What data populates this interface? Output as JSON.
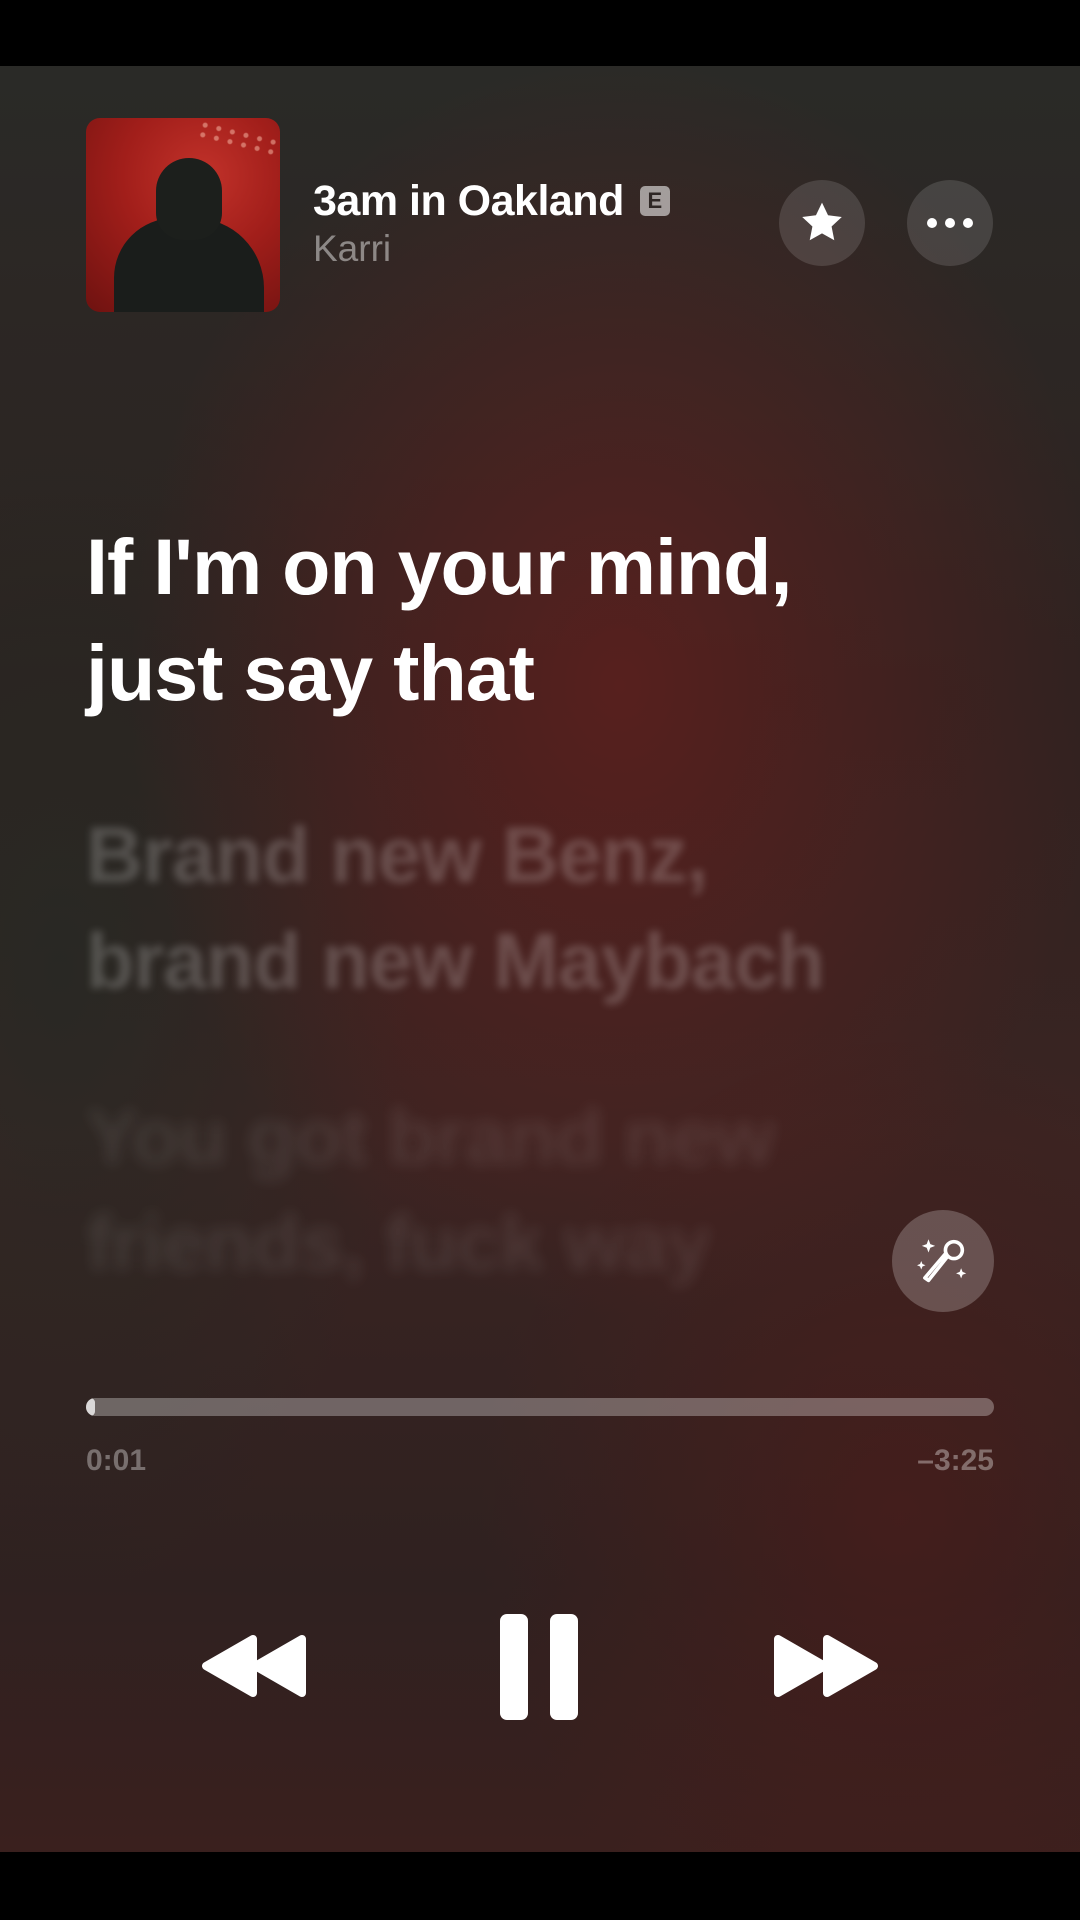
{
  "now_playing": {
    "title": "3am in Oakland",
    "explicit_badge": "E",
    "artist": "Karri",
    "artwork_icon": "album-artwork",
    "favorite_icon": "star-icon",
    "more_icon": "ellipsis-icon"
  },
  "lyrics": {
    "current": [
      "If I'm on your mind,",
      "just say that"
    ],
    "next": [
      "Brand new Benz,",
      "brand new Maybach"
    ],
    "later": [
      "You got brand new",
      "friends, fuck way"
    ]
  },
  "sing_icon": "microphone-sparkle-icon",
  "playback": {
    "elapsed": "0:01",
    "remaining": "–3:25",
    "progress_fraction": 0.005
  },
  "controls": {
    "rewind_icon": "backward-icon",
    "pause_icon": "pause-icon",
    "forward_icon": "forward-icon"
  },
  "colors": {
    "background_dark": "#2f2220",
    "accent_red": "#a11e1a",
    "text_primary": "#ffffff"
  }
}
